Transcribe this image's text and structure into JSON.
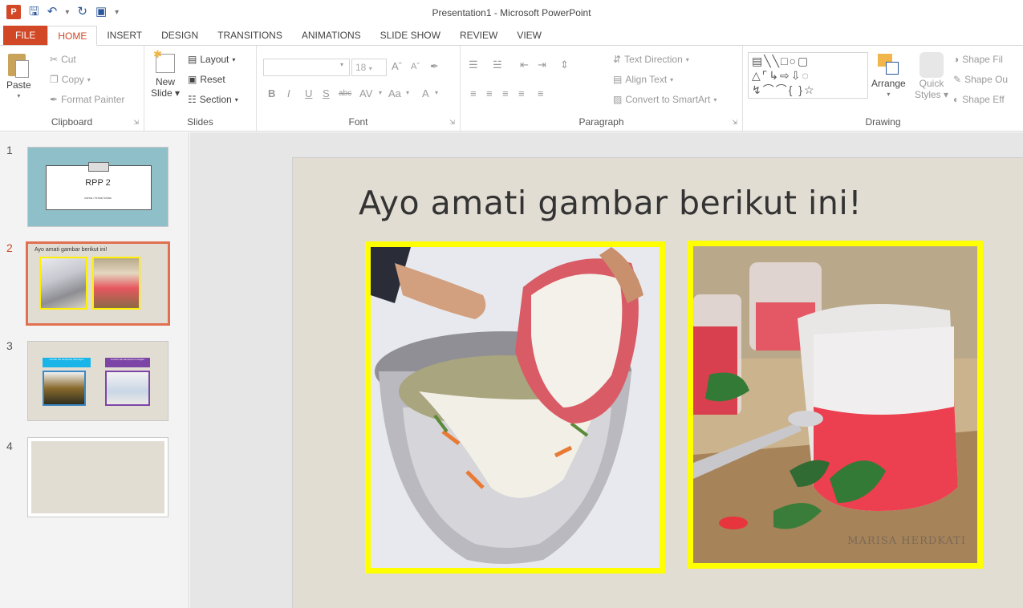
{
  "window": {
    "title": "Presentation1 - Microsoft PowerPoint"
  },
  "quick_access": {
    "app_icon": "powerpoint-icon",
    "save_icon": "save-icon",
    "undo_icon": "undo-icon",
    "redo_icon": "repeat-icon",
    "presenter_icon": "start-from-beginning-icon"
  },
  "tabs": [
    "FILE",
    "HOME",
    "INSERT",
    "DESIGN",
    "TRANSITIONS",
    "ANIMATIONS",
    "SLIDE SHOW",
    "REVIEW",
    "VIEW"
  ],
  "active_tab": "HOME",
  "ribbon": {
    "clipboard": {
      "label": "Clipboard",
      "paste": "Paste",
      "cut": "Cut",
      "copy": "Copy",
      "format_painter": "Format Painter"
    },
    "slides": {
      "label": "Slides",
      "new_slide_line1": "New",
      "new_slide_line2": "Slide",
      "layout": "Layout",
      "reset": "Reset",
      "section": "Section"
    },
    "font": {
      "label": "Font",
      "font_name": "",
      "font_size": "18"
    },
    "paragraph": {
      "label": "Paragraph",
      "text_direction": "Text Direction",
      "align_text": "Align Text",
      "convert_smartart": "Convert to SmartArt"
    },
    "drawing": {
      "label": "Drawing",
      "arrange": "Arrange",
      "quick_styles_line1": "Quick",
      "quick_styles_line2": "Styles",
      "shape_fill": "Shape Fil",
      "shape_outline": "Shape Ou",
      "shape_effects": "Shape Eff"
    }
  },
  "thumbnails": [
    {
      "number": "1",
      "title": "RPP 2",
      "subtitle": "nama / tema/ kelas"
    },
    {
      "number": "2",
      "title": "Ayo amati gambar berikut ini!"
    },
    {
      "number": "3",
      "label1": "Contoh zat campuran heterogen",
      "label2": "Contoh zat campuran homogen"
    },
    {
      "number": "4"
    }
  ],
  "selected_slide": 2,
  "slide": {
    "title": "Ayo amati gambar berikut ini!",
    "left_picture": "image of flour being poured onto shredded vegetables in a bowl",
    "right_picture": "image of glasses of red iced drink with mint leaves",
    "watermark": "MARISA HERDKATI"
  },
  "colors": {
    "accent": "#d24726",
    "slide_bg": "#e2ddd3",
    "picture_border": "#ffff00"
  }
}
